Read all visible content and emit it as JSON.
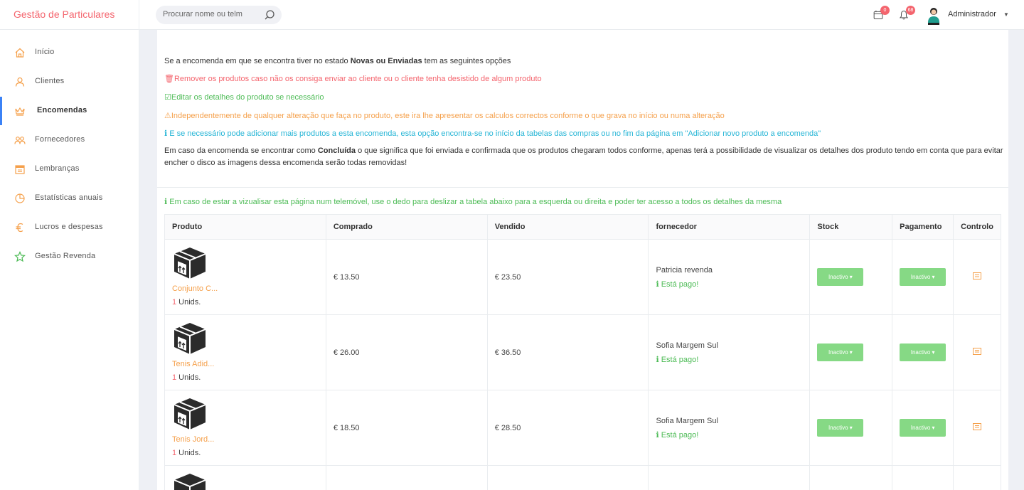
{
  "app": {
    "brand": "Gestão de Particulares"
  },
  "header": {
    "search_placeholder": "Procurar nome ou telm",
    "calendar_badge": "0",
    "notifications_badge": "68",
    "user_name": "Administrador"
  },
  "sidebar": {
    "items": [
      {
        "label": "Início",
        "icon": "home-icon"
      },
      {
        "label": "Clientes",
        "icon": "user-icon"
      },
      {
        "label": "Encomendas",
        "icon": "crown-icon",
        "active": true
      },
      {
        "label": "Fornecedores",
        "icon": "users-icon"
      },
      {
        "label": "Lembranças",
        "icon": "calendar-icon"
      },
      {
        "label": "Estatísticas anuais",
        "icon": "pie-chart-icon"
      },
      {
        "label": "Lucros e despesas",
        "icon": "euro-icon"
      },
      {
        "label": "Gestão Revenda",
        "icon": "star-icon"
      }
    ]
  },
  "info": {
    "intro_prefix": "Se a encomenda em que se encontra tiver no estado ",
    "intro_bold": "Novas ou Enviadas",
    "intro_suffix": " tem as seguintes opções",
    "remove": "🗑Remover os produtos caso não os consiga enviar ao cliente ou o cliente tenha desistido de algum produto",
    "edit": "☑Editar os detalhes do produto se necessário",
    "warning": "⚠Independentemente de qualquer alteração que faça no produto, este ira lhe apresentar os calculos correctos conforme o que grava no início ou numa alteração",
    "add": "ℹ E se necessário pode adicionar mais produtos a esta encomenda, esta opção encontra-se no início da tabelas das compras ou no fim da página em \"Adicionar novo produto a encomenda\"",
    "concluded_prefix": "Em caso da encomenda se encontrar como ",
    "concluded_bold": "Concluída",
    "concluded_suffix": " o que significa que foi enviada e confirmada que os produtos chegaram todos conforme, apenas terá a possibilidade de visualizar os detalhes dos produto tendo em conta que para evitar encher o disco as imagens dessa encomenda serão todas removidas!",
    "mobile_note": "ℹ Em caso de estar a vizualisar esta página num telemóvel, use o dedo para deslizar a tabela abaixo para a esquerda ou direita e poder ter acesso a todos os detalhes da mesma"
  },
  "table": {
    "headers": {
      "produto": "Produto",
      "comprado": "Comprado",
      "vendido": "Vendido",
      "fornecedor": "fornecedor",
      "stock": "Stock",
      "pagamento": "Pagamento",
      "controlo": "Controlo"
    },
    "rows": [
      {
        "name": "Conjunto C...",
        "qty": "1",
        "unit": " Unids.",
        "bought": "€ 13.50",
        "sold": "€ 23.50",
        "supplier": "Patricia revenda",
        "paid": "ℹ  Está pago!",
        "stock": "Inactivo",
        "payment": "Inactivo"
      },
      {
        "name": "Tenis Adid...",
        "qty": "1",
        "unit": " Unids.",
        "bought": "€ 26.00",
        "sold": "€ 36.50",
        "supplier": "Sofia Margem Sul",
        "paid": "ℹ  Está pago!",
        "stock": "Inactivo",
        "payment": "Inactivo"
      },
      {
        "name": "Tenis Jord...",
        "qty": "1",
        "unit": " Unids.",
        "bought": "€ 18.50",
        "sold": "€ 28.50",
        "supplier": "Sofia Margem Sul",
        "paid": "ℹ  Está pago!",
        "stock": "Inactivo",
        "payment": "Inactivo"
      }
    ]
  },
  "colors": {
    "brand": "#f4656e",
    "accent": "#3b82f6",
    "success": "#86d985",
    "warning": "#f5a04b",
    "info": "#26b5d6"
  }
}
